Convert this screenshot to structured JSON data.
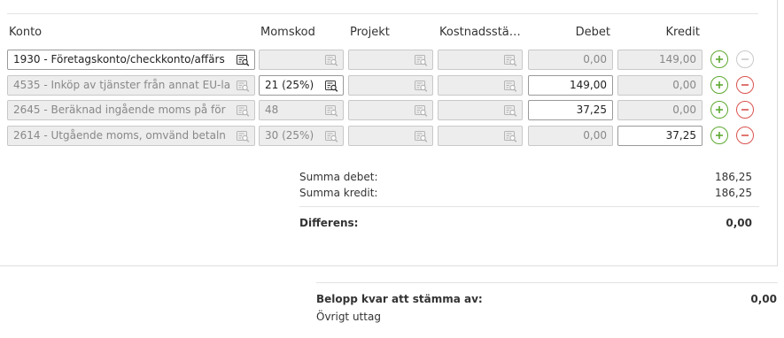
{
  "headers": {
    "konto": "Konto",
    "momskod": "Momskod",
    "projekt": "Projekt",
    "kostnadsstalle": "Kostnadsstä…",
    "debet": "Debet",
    "kredit": "Kredit"
  },
  "rows": [
    {
      "konto": "1930 - Företagskonto/checkkonto/affärs",
      "momskod": "",
      "projekt": "",
      "kostnadsstalle": "",
      "debet": "0,00",
      "kredit": "149,00"
    },
    {
      "konto": "4535 - Inköp av tjänster från annat EU-la",
      "momskod": "21 (25%)",
      "projekt": "",
      "kostnadsstalle": "",
      "debet": "149,00",
      "kredit": "0,00"
    },
    {
      "konto": "2645 - Beräknad ingående moms på för",
      "momskod": "48",
      "projekt": "",
      "kostnadsstalle": "",
      "debet": "37,25",
      "kredit": "0,00"
    },
    {
      "konto": "2614 - Utgående moms, omvänd betaln",
      "momskod": "30 (25%)",
      "projekt": "",
      "kostnadsstalle": "",
      "debet": "0,00",
      "kredit": "37,25"
    }
  ],
  "summary": {
    "debet_label": "Summa debet:",
    "debet_value": "186,25",
    "kredit_label": "Summa kredit:",
    "kredit_value": "186,25",
    "differens_label": "Differens:",
    "differens_value": "0,00"
  },
  "footer": {
    "belopp_label": "Belopp kvar att stämma av:",
    "belopp_value": "0,00",
    "ovrigt_label": "Övrigt uttag"
  },
  "icons": {
    "lookup": "search-list-icon",
    "add": "plus-circle-icon",
    "remove": "minus-circle-icon"
  },
  "colors": {
    "add": "#5ea832",
    "remove": "#d9534f",
    "disabled": "#c9c9c9"
  }
}
